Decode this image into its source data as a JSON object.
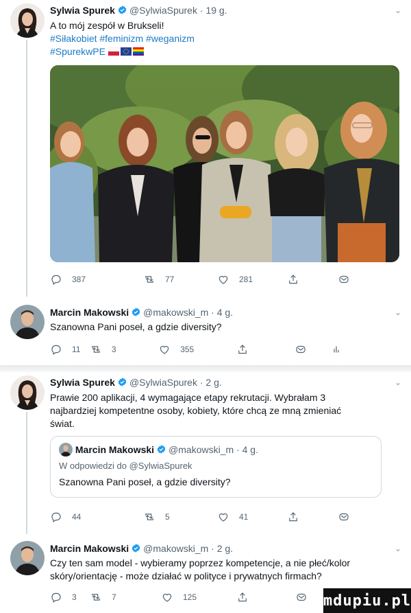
{
  "tweet1": {
    "author": "Sylwia Spurek",
    "handle": "@SylwiaSpurek",
    "time": "· 19 g.",
    "line1": "A to mój zespół w Brukseli!",
    "hashtags1": "#Siłakobiet #feminizm #weganizm",
    "hashtag2": "#SpurekwPE",
    "flags": [
      "polish-flag-icon",
      "eu-flag-icon",
      "rainbow-flag-icon"
    ],
    "replies": "387",
    "retweets": "77",
    "likes": "281"
  },
  "tweet2": {
    "author": "Marcin Makowski",
    "handle": "@makowski_m",
    "time": "· 4 g.",
    "text": "Szanowna Pani poseł, a gdzie diversity?",
    "replies": "11",
    "retweets": "3",
    "likes": "355"
  },
  "tweet3": {
    "author": "Sylwia Spurek",
    "handle": "@SylwiaSpurek",
    "time": "· 2 g.",
    "line1": "Prawie 200 aplikacji, 4 wymagające etapy rekrutacji. Wybrałam 3",
    "line2": "najbardziej kompetentne osoby, kobiety, które chcą ze mną zmieniać",
    "line3": "świat.",
    "quote": {
      "author": "Marcin Makowski",
      "handle": "@makowski_m",
      "time": "· 4 g.",
      "reply_to": "W odpowiedzi do @SylwiaSpurek",
      "text": "Szanowna Pani poseł, a gdzie diversity?"
    },
    "replies": "44",
    "retweets": "5",
    "likes": "41"
  },
  "tweet4": {
    "author": "Marcin Makowski",
    "handle": "@makowski_m",
    "time": "· 2 g.",
    "line1": "Czy ten sam model - wybieramy poprzez kompetencje, a nie płeć/kolor",
    "line2": "skóry/orientację - może działać w polityce i prywatnych firmach?",
    "replies": "3",
    "retweets": "7",
    "likes": "125"
  },
  "watermark": "mdupiu.pl",
  "colors": {
    "verified": "#1d9bf0",
    "hashtag": "#1b7ac7",
    "muted": "#536471",
    "border": "#cfd9de"
  }
}
